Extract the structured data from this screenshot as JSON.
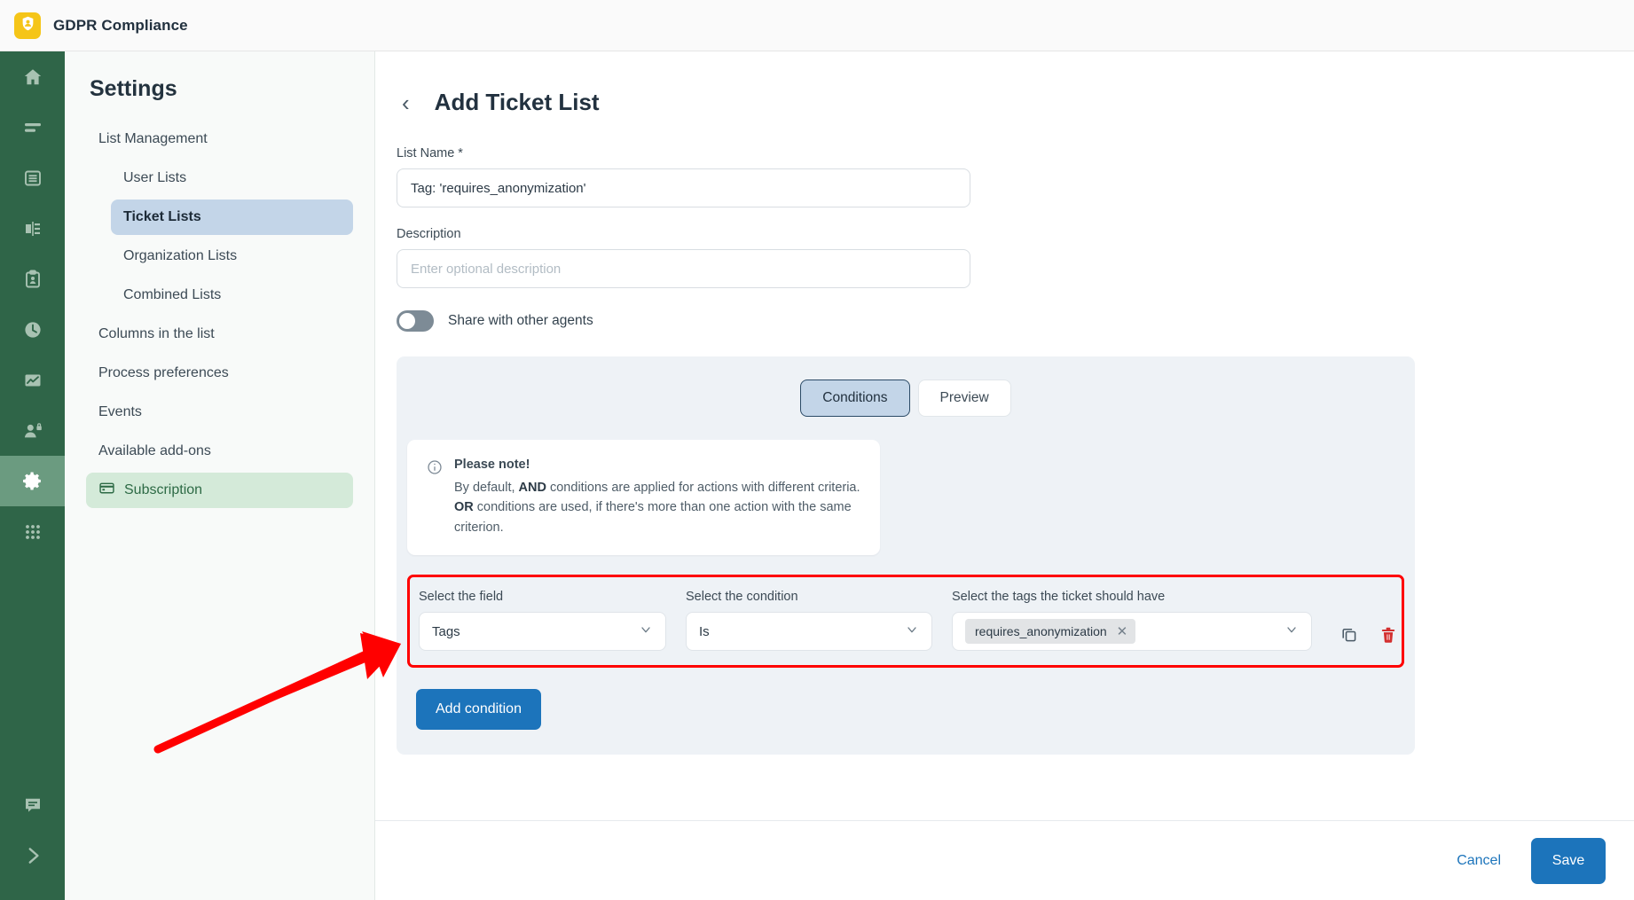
{
  "topbar": {
    "title": "GDPR Compliance",
    "logo_icon": "shield-person-icon"
  },
  "rail": {
    "items": [
      {
        "icon": "home-icon",
        "name": "home"
      },
      {
        "icon": "list-lines-icon",
        "name": "lists"
      },
      {
        "icon": "database-icon",
        "name": "database"
      },
      {
        "icon": "merge-icon",
        "name": "merge"
      },
      {
        "icon": "clipboard-person-icon",
        "name": "clipboard"
      },
      {
        "icon": "clock-icon",
        "name": "history"
      },
      {
        "icon": "chart-icon",
        "name": "reports"
      },
      {
        "icon": "user-lock-icon",
        "name": "privacy"
      },
      {
        "icon": "gear-icon",
        "name": "settings"
      },
      {
        "icon": "grid-apps-icon",
        "name": "apps"
      }
    ],
    "bottom_items": [
      {
        "icon": "chat-icon",
        "name": "chat"
      },
      {
        "icon": "chevron-right-icon",
        "name": "expand"
      }
    ]
  },
  "sidebar": {
    "title": "Settings",
    "items": [
      {
        "label": "List Management",
        "level": 0,
        "state": "normal",
        "icon": ""
      },
      {
        "label": "User Lists",
        "level": 1,
        "state": "normal",
        "icon": ""
      },
      {
        "label": "Ticket Lists",
        "level": 1,
        "state": "selected",
        "icon": ""
      },
      {
        "label": "Organization Lists",
        "level": 1,
        "state": "normal",
        "icon": ""
      },
      {
        "label": "Combined Lists",
        "level": 1,
        "state": "normal",
        "icon": ""
      },
      {
        "label": "Columns in the list",
        "level": 0,
        "state": "normal",
        "icon": ""
      },
      {
        "label": "Process preferences",
        "level": 0,
        "state": "normal",
        "icon": ""
      },
      {
        "label": "Events",
        "level": 0,
        "state": "normal",
        "icon": ""
      },
      {
        "label": "Available add-ons",
        "level": 0,
        "state": "normal",
        "icon": ""
      },
      {
        "label": "Subscription",
        "level": 0,
        "state": "highlight",
        "icon": "credit-card-icon"
      }
    ]
  },
  "main": {
    "back_icon": "chevron-left-icon",
    "page_title": "Add Ticket List",
    "list_name": {
      "label": "List Name *",
      "value": "Tag: 'requires_anonymization'",
      "placeholder": ""
    },
    "description": {
      "label": "Description",
      "value": "",
      "placeholder": "Enter optional description"
    },
    "share_toggle": {
      "label": "Share with other agents",
      "state": "off"
    },
    "tabs": [
      {
        "label": "Conditions",
        "active": true
      },
      {
        "label": "Preview",
        "active": false
      }
    ],
    "note": {
      "icon": "info-icon",
      "title": "Please note!",
      "line1_pre": "By default, ",
      "line1_bold": "AND",
      "line1_post": " conditions are applied for actions with different criteria.",
      "line2_bold": "OR",
      "line2_post": " conditions are used, if there's more than one action with the same criterion."
    },
    "condition_row": {
      "field": {
        "label": "Select the field",
        "value": "Tags"
      },
      "condition": {
        "label": "Select the condition",
        "value": "Is"
      },
      "tags": {
        "label": "Select the tags the ticket should have",
        "chips": [
          "requires_anonymization"
        ]
      },
      "copy_icon": "copy-icon",
      "delete_icon": "trash-icon"
    },
    "add_condition_label": "Add condition"
  },
  "footer": {
    "cancel_label": "Cancel",
    "save_label": "Save"
  },
  "annotation": {
    "type": "arrow",
    "color": "#ff0000"
  },
  "colors": {
    "rail_green": "#2f6548",
    "brand_yellow": "#f5c518",
    "primary_blue": "#1c74bb",
    "selected_blue": "#c3d5e8",
    "highlight_green": "#d4ead9",
    "panel_bg": "#eef2f6",
    "annotation_red": "#ff0000",
    "trash_red": "#d32f2f"
  }
}
